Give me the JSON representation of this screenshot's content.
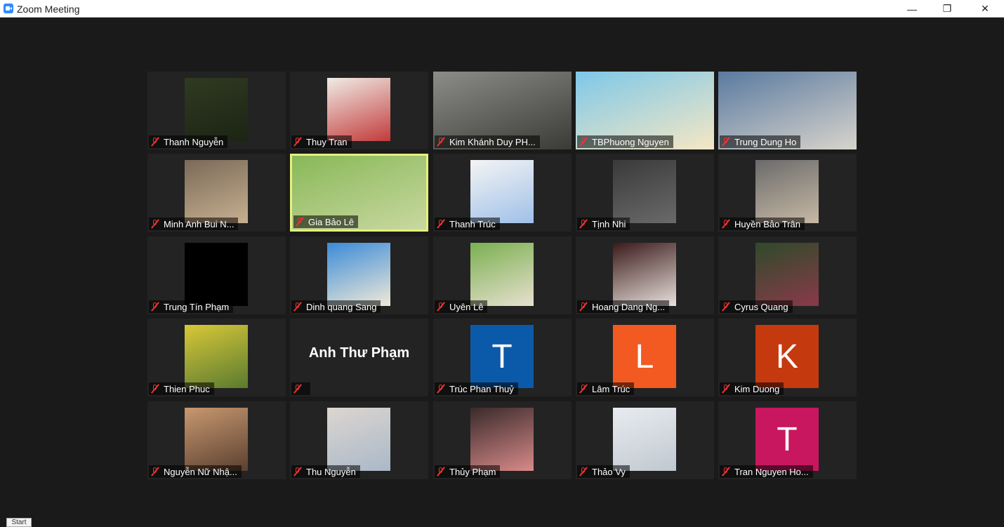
{
  "window": {
    "title": "Zoom Meeting",
    "controls": {
      "minimize": "—",
      "maximize": "❐",
      "close": "✕"
    }
  },
  "participants": [
    {
      "name": "Thanh Nguyễn",
      "video": "photo"
    },
    {
      "name": "Thuy Tran",
      "video": "photo"
    },
    {
      "name": "Kim Khánh Duy PH...",
      "video": "camera"
    },
    {
      "name": "TBPhuong Nguyen",
      "video": "camera"
    },
    {
      "name": "Trung Dung Ho",
      "video": "camera"
    },
    {
      "name": "Minh Anh Bui N...",
      "video": "photo"
    },
    {
      "name": "Gia Bảo Lê",
      "video": "camera",
      "active_speaker": true
    },
    {
      "name": "Thanh Trúc",
      "video": "photo"
    },
    {
      "name": "Tịnh Nhi",
      "video": "photo"
    },
    {
      "name": "Huyền Bảo Trân",
      "video": "photo"
    },
    {
      "name": "Trung Tín Phạm",
      "video": "photo"
    },
    {
      "name": "Dinh quang Sang",
      "video": "photo"
    },
    {
      "name": "Uyên Lê",
      "video": "photo"
    },
    {
      "name": "Hoang Dang Ng...",
      "video": "photo"
    },
    {
      "name": "Cyrus Quang",
      "video": "photo"
    },
    {
      "name": "Thien Phuc",
      "video": "photo"
    },
    {
      "name": "",
      "video": "name-only",
      "big_name": "Anh Thư Phạm"
    },
    {
      "name": "Trúc Phan Thuỷ",
      "video": "initial",
      "initial": "T",
      "color": "#0b5aa9"
    },
    {
      "name": "Lâm Trúc",
      "video": "initial",
      "initial": "L",
      "color": "#f25a22"
    },
    {
      "name": "Kim Duong",
      "video": "initial",
      "initial": "K",
      "color": "#c5390f"
    },
    {
      "name": "Nguyễn Nữ Nhậ...",
      "video": "photo"
    },
    {
      "name": "Thu Nguyễn",
      "video": "photo"
    },
    {
      "name": "Thủy Phạm",
      "video": "photo"
    },
    {
      "name": "Thảo Vy",
      "video": "photo"
    },
    {
      "name": "Tran Nguyen Ho...",
      "video": "initial",
      "initial": "T",
      "color": "#c8175f"
    }
  ],
  "taskbar": {
    "start_label": "Start"
  }
}
